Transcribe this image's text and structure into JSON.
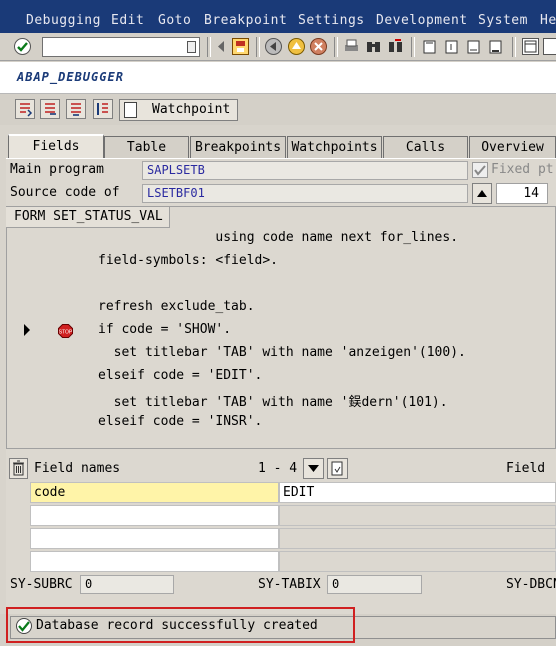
{
  "menu": [
    "Debugging",
    "Edit",
    "Goto",
    "Breakpoint",
    "Settings",
    "Development",
    "System",
    "He"
  ],
  "toolbar": {
    "command_value": ""
  },
  "title": "ABAP_DEBUGGER",
  "app_toolbar": {
    "watchpoint_label": "Watchpoint"
  },
  "tabs": [
    {
      "label": "Fields",
      "active": true
    },
    {
      "label": "Table"
    },
    {
      "label": "Breakpoints"
    },
    {
      "label": "Watchpoints"
    },
    {
      "label": "Calls"
    },
    {
      "label": "Overview"
    }
  ],
  "info": {
    "main_program_label": "Main program",
    "main_program_value": "SAPLSETB",
    "fixed_label": "Fixed pt",
    "source_code_label": "Source code of",
    "source_code_value": "LSETBF01",
    "line_value": "14"
  },
  "code": {
    "header": "FORM SET_STATUS_VAL",
    "lines": [
      "               using code name next for_lines.",
      "field-symbols: <field>.",
      "",
      "refresh exclude_tab.",
      "if code = 'SHOW'.",
      "  set titlebar 'TAB' with name 'anzeigen'(100).",
      "elseif code = 'EDIT'.",
      "  set titlebar 'TAB' with name '鋘dern'(101).",
      "elseif code = 'INSR'."
    ],
    "breakpoint_label": "STOP"
  },
  "fields": {
    "field_names_label": "Field names",
    "range": "1 - 4",
    "field_label": "Field",
    "rows": [
      {
        "name": "code",
        "value": "EDIT"
      },
      {
        "name": "",
        "value": ""
      },
      {
        "name": "",
        "value": ""
      },
      {
        "name": "",
        "value": ""
      }
    ]
  },
  "sysvars": {
    "subrc_label": "SY-SUBRC",
    "subrc_value": "0",
    "tabix_label": "SY-TABIX",
    "tabix_value": "0",
    "dbcnt_label": "SY-DBCN"
  },
  "status": {
    "message": "Database record successfully created"
  },
  "colors": {
    "menubar": "#1a3a78",
    "highlight_row": "#fff4a8",
    "status_frame": "#d02020"
  }
}
